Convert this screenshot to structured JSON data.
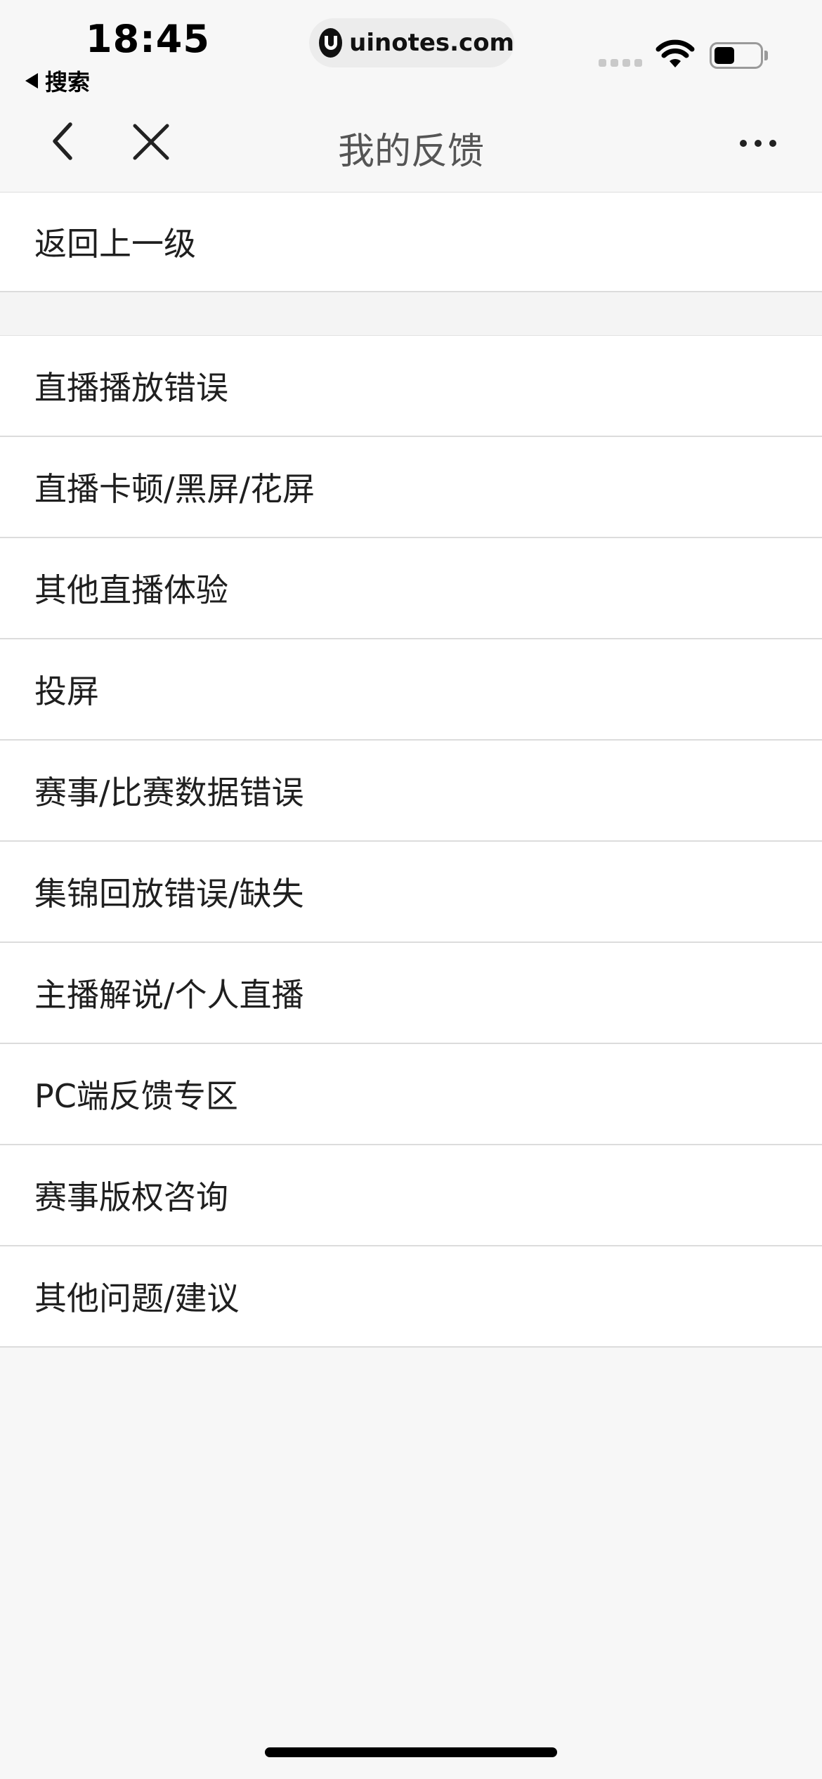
{
  "status_bar": {
    "time": "18:45",
    "back_app_label": "搜索",
    "url": "uinotes.com",
    "battery_level": 0.45
  },
  "nav": {
    "title": "我的反馈",
    "back_icon": "chevron-left-icon",
    "close_icon": "close-icon",
    "more_icon": "more-horizontal-icon"
  },
  "list": {
    "top_item": "返回上一级",
    "items": [
      "直播播放错误",
      "直播卡顿/黑屏/花屏",
      "其他直播体验",
      "投屏",
      "赛事/比赛数据错误",
      "集锦回放错误/缺失",
      "主播解说/个人直播",
      "PC端反馈专区",
      "赛事版权咨询",
      "其他问题/建议"
    ]
  }
}
